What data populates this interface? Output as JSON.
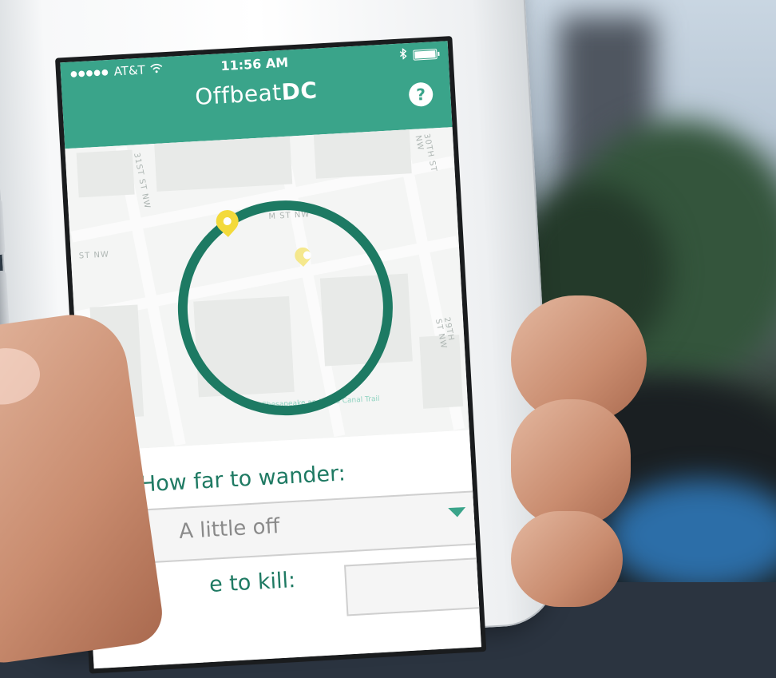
{
  "status_bar": {
    "signal_dots": "●●●●●",
    "carrier": "AT&T",
    "time": "11:56 AM"
  },
  "header": {
    "title_light": "Offbeat",
    "title_bold": "DC",
    "help_label": "?"
  },
  "map": {
    "street_labels": [
      "M ST NW",
      "ST NW",
      "31ST ST NW",
      "30TH ST NW",
      "29TH ST NW",
      "Chesapeake and Ohio Canal Trail"
    ]
  },
  "form": {
    "distance_question": "How far to wander:",
    "distance_selected": "A little off",
    "time_question_partial": "e to kill:"
  },
  "colors": {
    "brand": "#3aa48a",
    "ring": "#1d7a63",
    "pin": "#f3da3b"
  }
}
